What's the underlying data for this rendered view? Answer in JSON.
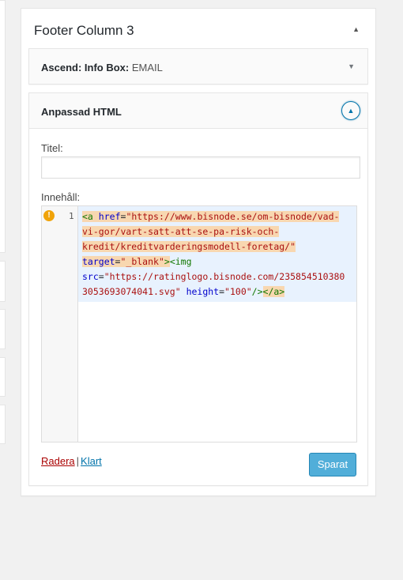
{
  "sidebar": {
    "title": "Footer Column 3",
    "toggle_icon": "triangle-up-icon"
  },
  "widget_closed": {
    "title": "Ascend: Info Box:",
    "instance_title": " EMAIL",
    "toggle_icon": "triangle-down-icon"
  },
  "widget_open": {
    "title": "Anpassad HTML",
    "toggle_icon": "circle-arrow-up-icon",
    "title_label": "Titel:",
    "title_value": "",
    "content_label": "Innehåll:",
    "line_number": "1",
    "lint_icon": "warning-icon",
    "code": {
      "a_open": "<a",
      "href_attr": "href",
      "eq": "=",
      "href_val_1": "\"https://www.bisnode.se/om-bisnode/vad-",
      "href_val_2": "vi-gor/vart-satt-att-se-pa-risk-och-",
      "href_val_3": "kredit/kreditvarderingsmodell-foretag/\"",
      "target_attr": "target",
      "target_val": "\"_blank\"",
      "gt": ">",
      "img_open": "<img",
      "src_attr": "src",
      "src_val_1": "\"https://ratinglogo.bisnode.com/235854510380",
      "src_val_2": "3053693074041.svg\"",
      "height_attr": "height",
      "height_val": "\"100\"",
      "img_close": "/>",
      "a_close": "</a>"
    },
    "delete_label": "Radera",
    "separator": "|",
    "done_label": "Klart",
    "save_label": "Sparat"
  },
  "colors": {
    "accent": "#0073aa",
    "delete": "#a00",
    "code_bg": "#e8f2fe",
    "match_highlight": "#f8d7b0"
  }
}
